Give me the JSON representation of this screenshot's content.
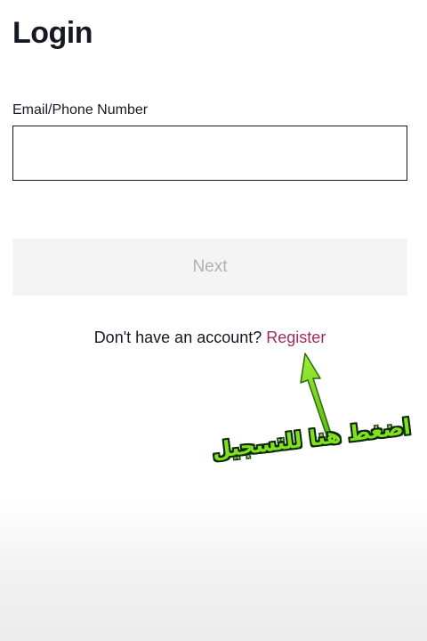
{
  "header": {
    "title": "Login"
  },
  "form": {
    "email_label": "Email/Phone Number",
    "email_value": "",
    "email_placeholder": "",
    "next_label": "Next"
  },
  "register": {
    "prompt": "Don't have an account?",
    "link_label": "Register",
    "link_color": "#a52a5a"
  },
  "overlay": {
    "annotation_text": "اضغط هنا للتسجيل",
    "annotation_color": "#84e01f",
    "arrow_icon": "arrow-up-icon"
  }
}
